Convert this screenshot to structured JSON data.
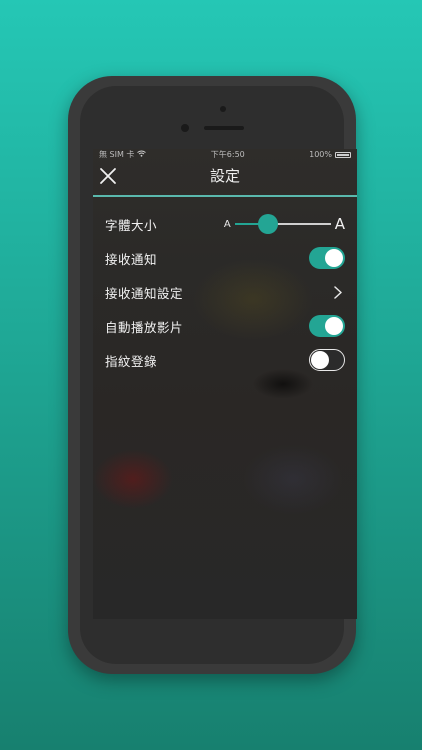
{
  "statusbar": {
    "carrier": "無 SIM 卡",
    "wifi_icon": "wifi-icon",
    "time": "下午6:50",
    "battery": "100%"
  },
  "nav": {
    "title": "設定",
    "close_icon": "close-icon"
  },
  "settings": {
    "font_size": {
      "label": "字體大小",
      "small_label": "A",
      "large_label": "A",
      "value_fraction": 0.35
    },
    "notifications": {
      "label": "接收通知",
      "enabled": true
    },
    "notification_settings": {
      "label": "接收通知設定",
      "icon": "chevron-right-icon"
    },
    "autoplay_video": {
      "label": "自動播放影片",
      "enabled": true
    },
    "fingerprint_login": {
      "label": "指紋登錄",
      "enabled": false
    }
  },
  "colors": {
    "accent": "#23a594",
    "background_top": "#25c7b5",
    "background_bottom": "#17806f"
  }
}
